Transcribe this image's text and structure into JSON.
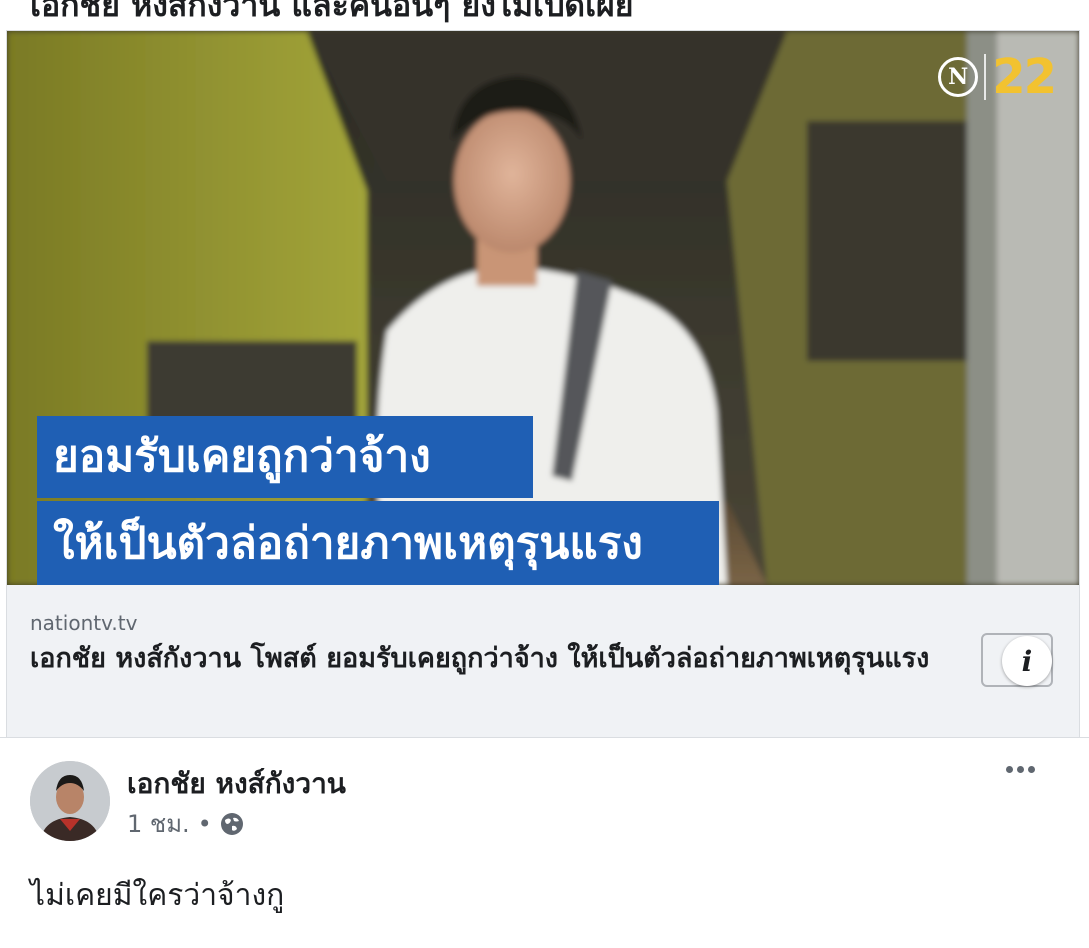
{
  "top_strip": {
    "text": "เอกชัย หงส์กังวาน และคนอื่นๆ ยังไม่เปิดเผย"
  },
  "link_preview": {
    "logo": {
      "letter": "N",
      "number": "22",
      "icon": "nation-logo-icon",
      "number_color": "#f2c230"
    },
    "caption_line_1": "ยอมรับเคยถูกว่าจ้าง",
    "caption_line_2": "ให้เป็นตัวล่อถ่ายภาพเหตุรุนแรง",
    "caption_color": "#1f5fb4",
    "domain": "nationtv.tv",
    "headline": "เอกชัย หงส์กังวาน โพสต์ ยอมรับเคยถูกว่าจ้าง ให้เป็นตัวล่อถ่ายภาพเหตุรุนแรง",
    "info_icon": "info-icon",
    "info_glyph": "i"
  },
  "comment": {
    "author": "เอกชัย หงส์กังวาน",
    "time": "1 ชม.",
    "separator": "•",
    "privacy_icon": "globe-icon",
    "more_icon": "more-options-icon",
    "text": "ไม่เคยมีใครว่าจ้างกู"
  }
}
